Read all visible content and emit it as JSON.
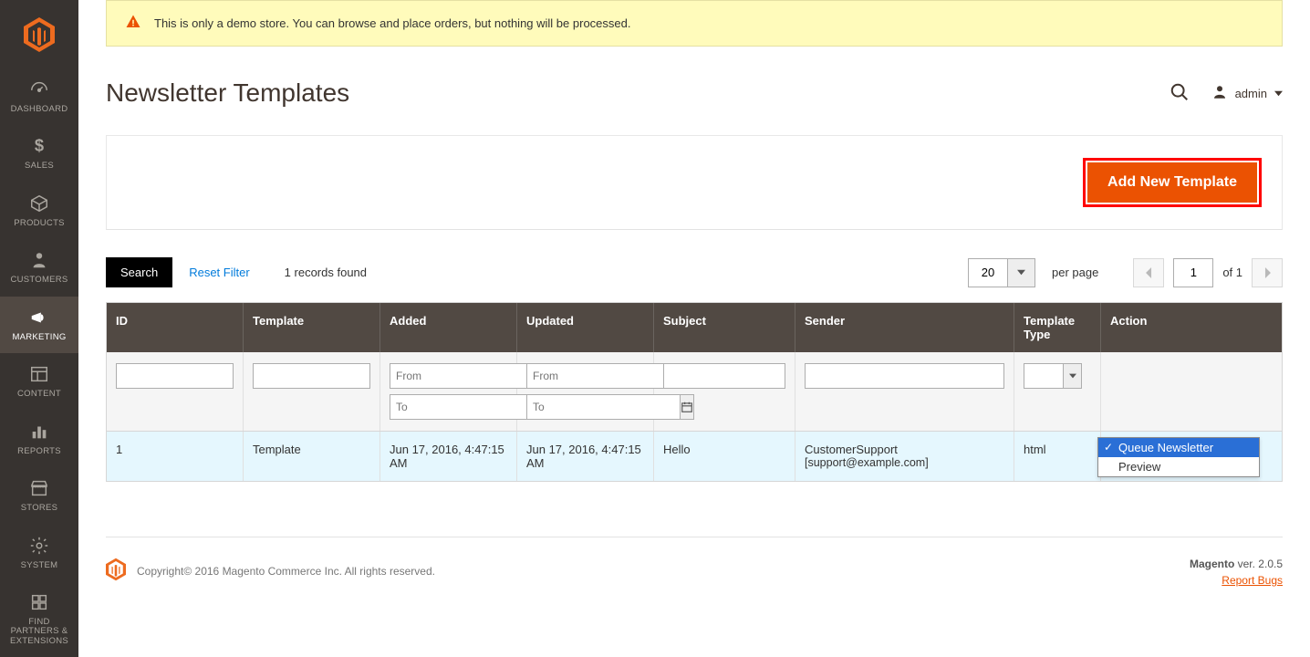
{
  "banner": {
    "text": "This is only a demo store. You can browse and place orders, but nothing will be processed."
  },
  "header": {
    "page_title": "Newsletter Templates",
    "user_label": "admin"
  },
  "actions": {
    "add_new_template": "Add New Template"
  },
  "nav": {
    "items": [
      {
        "label": "DASHBOARD",
        "icon": "gauge-icon"
      },
      {
        "label": "SALES",
        "icon": "dollar-icon"
      },
      {
        "label": "PRODUCTS",
        "icon": "box-icon"
      },
      {
        "label": "CUSTOMERS",
        "icon": "person-icon"
      },
      {
        "label": "MARKETING",
        "icon": "megaphone-icon",
        "active": true
      },
      {
        "label": "CONTENT",
        "icon": "layout-icon"
      },
      {
        "label": "REPORTS",
        "icon": "bars-icon"
      },
      {
        "label": "STORES",
        "icon": "storefront-icon"
      },
      {
        "label": "SYSTEM",
        "icon": "gear-icon"
      },
      {
        "label": "FIND PARTNERS & EXTENSIONS",
        "icon": "blocks-icon"
      }
    ]
  },
  "toolbar": {
    "search_label": "Search",
    "reset_label": "Reset Filter",
    "records_found": "1 records found",
    "perpage_value": "20",
    "perpage_label": "per page",
    "page_value": "1",
    "of_label": "of 1"
  },
  "grid": {
    "columns": {
      "id": "ID",
      "template": "Template",
      "added": "Added",
      "updated": "Updated",
      "subject": "Subject",
      "sender": "Sender",
      "type": "Template Type",
      "action": "Action"
    },
    "filter_placeholders": {
      "from": "From",
      "to": "To"
    },
    "rows": [
      {
        "id": "1",
        "template": "Template",
        "added": "Jun 17, 2016, 4:47:15 AM",
        "updated": "Jun 17, 2016, 4:47:15 AM",
        "subject": "Hello",
        "sender_name": "CustomerSupport",
        "sender_email": "[support@example.com]",
        "type": "html"
      }
    ],
    "action_options": [
      {
        "label": "Queue Newsletter",
        "selected": true
      },
      {
        "label": "Preview",
        "selected": false
      }
    ]
  },
  "footer": {
    "copyright": "Copyright© 2016 Magento Commerce Inc. All rights reserved.",
    "brand": "Magento",
    "version": " ver. 2.0.5",
    "report_bugs": "Report Bugs"
  }
}
